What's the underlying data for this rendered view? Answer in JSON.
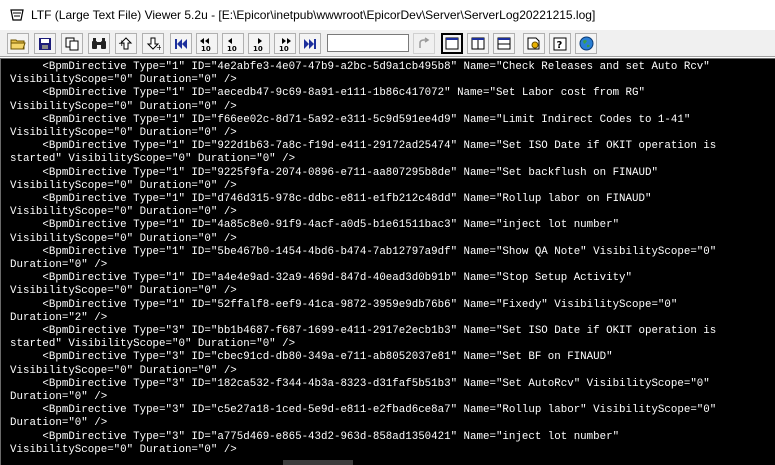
{
  "window": {
    "title": "LTF (Large Text File) Viewer 5.2u - [E:\\Epicor\\inetpub\\wwwroot\\EpicorDev\\Server\\ServerLog20221215.log]"
  },
  "toolbar": {
    "search_value": "",
    "buttons": [
      {
        "name": "open-folder-icon"
      },
      {
        "name": "save-icon"
      },
      {
        "name": "copy-icon"
      },
      {
        "name": "find-binoculars-icon"
      },
      {
        "name": "find-previous-icon"
      },
      {
        "name": "find-next-icon"
      },
      {
        "name": "first-page-icon"
      },
      {
        "name": "back-10-icon"
      },
      {
        "name": "back-1-icon"
      },
      {
        "name": "forward-1-icon"
      },
      {
        "name": "forward-10-icon"
      },
      {
        "name": "last-page-icon"
      },
      {
        "name": "go-arrow-icon"
      },
      {
        "name": "single-pane-icon"
      },
      {
        "name": "split-vertical-icon"
      },
      {
        "name": "split-horizontal-icon"
      },
      {
        "name": "settings-icon"
      },
      {
        "name": "help-icon"
      },
      {
        "name": "web-globe-icon"
      }
    ]
  },
  "log_lines": [
    "     <BpmDirective Type=\"1\" ID=\"4e2abfe3-4e07-47b9-a2bc-5d9a1cb495b8\" Name=\"Check Releases and set Auto Rcv\"",
    "VisibilityScope=\"0\" Duration=\"0\" />",
    "     <BpmDirective Type=\"1\" ID=\"aecedb47-9c69-8a91-e111-1b86c417072\" Name=\"Set Labor cost from RG\"",
    "VisibilityScope=\"0\" Duration=\"0\" />",
    "     <BpmDirective Type=\"1\" ID=\"f66ee02c-8d71-5a92-e311-5c9d591ee4d9\" Name=\"Limit Indirect Codes to 1-41\"",
    "VisibilityScope=\"0\" Duration=\"0\" />",
    "     <BpmDirective Type=\"1\" ID=\"922d1b63-7a8c-f19d-e411-29172ad25474\" Name=\"Set ISO Date if OKIT operation is",
    "started\" VisibilityScope=\"0\" Duration=\"0\" />",
    "     <BpmDirective Type=\"1\" ID=\"9225f9fa-2074-0896-e711-aa807295b8de\" Name=\"Set backflush on FINAUD\"",
    "VisibilityScope=\"0\" Duration=\"0\" />",
    "     <BpmDirective Type=\"1\" ID=\"d746d315-978c-ddbc-e811-e1fb212c48dd\" Name=\"Rollup labor on FINAUD\"",
    "VisibilityScope=\"0\" Duration=\"0\" />",
    "     <BpmDirective Type=\"1\" ID=\"4a85c8e0-91f9-4acf-a0d5-b1e61511bac3\" Name=\"inject lot number\"",
    "VisibilityScope=\"0\" Duration=\"0\" />",
    "     <BpmDirective Type=\"1\" ID=\"5be467b0-1454-4bd6-b474-7ab12797a9df\" Name=\"Show QA Note\" VisibilityScope=\"0\"",
    "Duration=\"0\" />",
    "     <BpmDirective Type=\"1\" ID=\"a4e4e9ad-32a9-469d-847d-40ead3d0b91b\" Name=\"Stop Setup Activity\"",
    "VisibilityScope=\"0\" Duration=\"0\" />",
    "     <BpmDirective Type=\"1\" ID=\"52ffalf8-eef9-41ca-9872-3959e9db76b6\" Name=\"Fixedy\" VisibilityScope=\"0\"",
    "Duration=\"2\" />",
    "     <BpmDirective Type=\"3\" ID=\"bb1b4687-f687-1699-e411-2917e2ecb1b3\" Name=\"Set ISO Date if OKIT operation is",
    "started\" VisibilityScope=\"0\" Duration=\"0\" />",
    "     <BpmDirective Type=\"3\" ID=\"cbec91cd-db80-349a-e711-ab8052037e81\" Name=\"Set BF on FINAUD\"",
    "VisibilityScope=\"0\" Duration=\"0\" />",
    "     <BpmDirective Type=\"3\" ID=\"182ca532-f344-4b3a-8323-d31faf5b51b3\" Name=\"Set AutoRcv\" VisibilityScope=\"0\"",
    "Duration=\"0\" />",
    "     <BpmDirective Type=\"3\" ID=\"c5e27a18-1ced-5e9d-e811-e2fbad6ce8a7\" Name=\"Rollup labor\" VisibilityScope=\"0\"",
    "Duration=\"0\" />",
    "     <BpmDirective Type=\"3\" ID=\"a775d469-e865-43d2-963d-858ad1350421\" Name=\"inject lot number\"",
    "VisibilityScope=\"0\" Duration=\"0\" />"
  ]
}
